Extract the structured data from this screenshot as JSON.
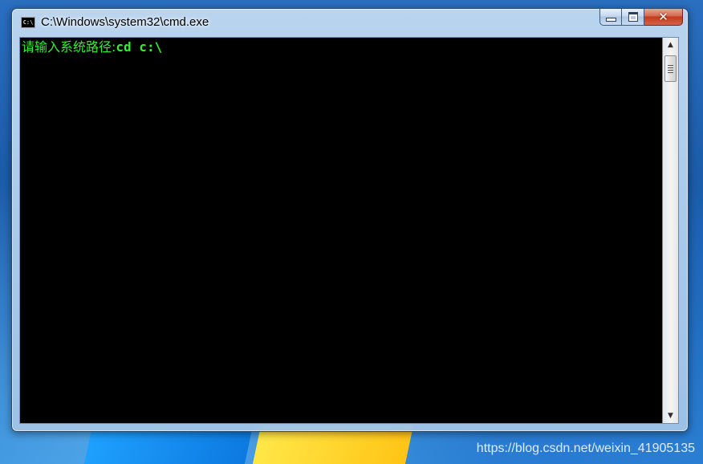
{
  "window": {
    "title": "C:\\Windows\\system32\\cmd.exe",
    "icon": "console-app-icon",
    "icon_label": "C:\\",
    "controls": {
      "minimize": "minimize-icon",
      "maximize": "maximize-icon",
      "close": "close-icon"
    }
  },
  "console": {
    "lines": [
      {
        "prompt": "请输入系统路径:",
        "input": "cd c:\\"
      }
    ],
    "text_color": "#33ee33",
    "background": "#000000"
  },
  "scrollbar": {
    "up": "scroll-up-icon",
    "down": "scroll-down-icon"
  },
  "watermark": "https://blog.csdn.net/weixin_41905135"
}
